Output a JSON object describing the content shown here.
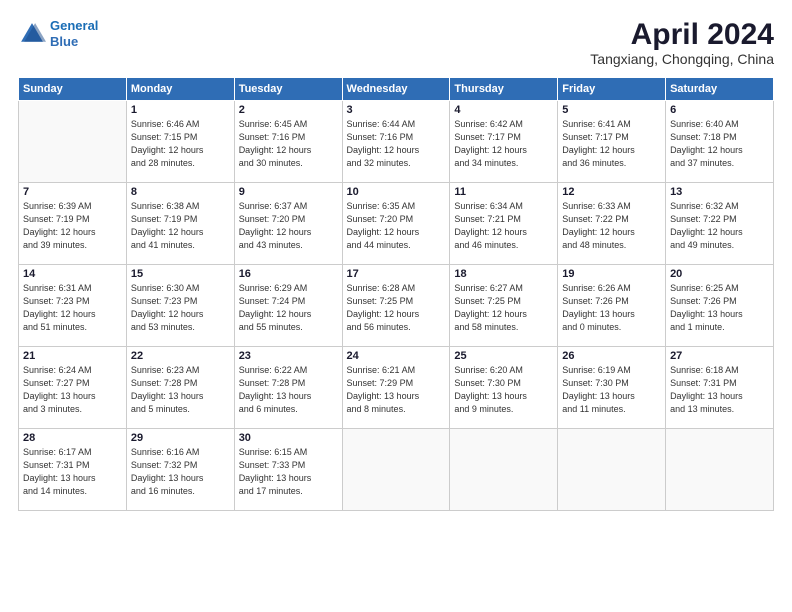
{
  "header": {
    "logo_line1": "General",
    "logo_line2": "Blue",
    "title": "April 2024",
    "location": "Tangxiang, Chongqing, China"
  },
  "days_of_week": [
    "Sunday",
    "Monday",
    "Tuesday",
    "Wednesday",
    "Thursday",
    "Friday",
    "Saturday"
  ],
  "weeks": [
    [
      {
        "num": "",
        "info": ""
      },
      {
        "num": "1",
        "info": "Sunrise: 6:46 AM\nSunset: 7:15 PM\nDaylight: 12 hours\nand 28 minutes."
      },
      {
        "num": "2",
        "info": "Sunrise: 6:45 AM\nSunset: 7:16 PM\nDaylight: 12 hours\nand 30 minutes."
      },
      {
        "num": "3",
        "info": "Sunrise: 6:44 AM\nSunset: 7:16 PM\nDaylight: 12 hours\nand 32 minutes."
      },
      {
        "num": "4",
        "info": "Sunrise: 6:42 AM\nSunset: 7:17 PM\nDaylight: 12 hours\nand 34 minutes."
      },
      {
        "num": "5",
        "info": "Sunrise: 6:41 AM\nSunset: 7:17 PM\nDaylight: 12 hours\nand 36 minutes."
      },
      {
        "num": "6",
        "info": "Sunrise: 6:40 AM\nSunset: 7:18 PM\nDaylight: 12 hours\nand 37 minutes."
      }
    ],
    [
      {
        "num": "7",
        "info": "Sunrise: 6:39 AM\nSunset: 7:19 PM\nDaylight: 12 hours\nand 39 minutes."
      },
      {
        "num": "8",
        "info": "Sunrise: 6:38 AM\nSunset: 7:19 PM\nDaylight: 12 hours\nand 41 minutes."
      },
      {
        "num": "9",
        "info": "Sunrise: 6:37 AM\nSunset: 7:20 PM\nDaylight: 12 hours\nand 43 minutes."
      },
      {
        "num": "10",
        "info": "Sunrise: 6:35 AM\nSunset: 7:20 PM\nDaylight: 12 hours\nand 44 minutes."
      },
      {
        "num": "11",
        "info": "Sunrise: 6:34 AM\nSunset: 7:21 PM\nDaylight: 12 hours\nand 46 minutes."
      },
      {
        "num": "12",
        "info": "Sunrise: 6:33 AM\nSunset: 7:22 PM\nDaylight: 12 hours\nand 48 minutes."
      },
      {
        "num": "13",
        "info": "Sunrise: 6:32 AM\nSunset: 7:22 PM\nDaylight: 12 hours\nand 49 minutes."
      }
    ],
    [
      {
        "num": "14",
        "info": "Sunrise: 6:31 AM\nSunset: 7:23 PM\nDaylight: 12 hours\nand 51 minutes."
      },
      {
        "num": "15",
        "info": "Sunrise: 6:30 AM\nSunset: 7:23 PM\nDaylight: 12 hours\nand 53 minutes."
      },
      {
        "num": "16",
        "info": "Sunrise: 6:29 AM\nSunset: 7:24 PM\nDaylight: 12 hours\nand 55 minutes."
      },
      {
        "num": "17",
        "info": "Sunrise: 6:28 AM\nSunset: 7:25 PM\nDaylight: 12 hours\nand 56 minutes."
      },
      {
        "num": "18",
        "info": "Sunrise: 6:27 AM\nSunset: 7:25 PM\nDaylight: 12 hours\nand 58 minutes."
      },
      {
        "num": "19",
        "info": "Sunrise: 6:26 AM\nSunset: 7:26 PM\nDaylight: 13 hours\nand 0 minutes."
      },
      {
        "num": "20",
        "info": "Sunrise: 6:25 AM\nSunset: 7:26 PM\nDaylight: 13 hours\nand 1 minute."
      }
    ],
    [
      {
        "num": "21",
        "info": "Sunrise: 6:24 AM\nSunset: 7:27 PM\nDaylight: 13 hours\nand 3 minutes."
      },
      {
        "num": "22",
        "info": "Sunrise: 6:23 AM\nSunset: 7:28 PM\nDaylight: 13 hours\nand 5 minutes."
      },
      {
        "num": "23",
        "info": "Sunrise: 6:22 AM\nSunset: 7:28 PM\nDaylight: 13 hours\nand 6 minutes."
      },
      {
        "num": "24",
        "info": "Sunrise: 6:21 AM\nSunset: 7:29 PM\nDaylight: 13 hours\nand 8 minutes."
      },
      {
        "num": "25",
        "info": "Sunrise: 6:20 AM\nSunset: 7:30 PM\nDaylight: 13 hours\nand 9 minutes."
      },
      {
        "num": "26",
        "info": "Sunrise: 6:19 AM\nSunset: 7:30 PM\nDaylight: 13 hours\nand 11 minutes."
      },
      {
        "num": "27",
        "info": "Sunrise: 6:18 AM\nSunset: 7:31 PM\nDaylight: 13 hours\nand 13 minutes."
      }
    ],
    [
      {
        "num": "28",
        "info": "Sunrise: 6:17 AM\nSunset: 7:31 PM\nDaylight: 13 hours\nand 14 minutes."
      },
      {
        "num": "29",
        "info": "Sunrise: 6:16 AM\nSunset: 7:32 PM\nDaylight: 13 hours\nand 16 minutes."
      },
      {
        "num": "30",
        "info": "Sunrise: 6:15 AM\nSunset: 7:33 PM\nDaylight: 13 hours\nand 17 minutes."
      },
      {
        "num": "",
        "info": ""
      },
      {
        "num": "",
        "info": ""
      },
      {
        "num": "",
        "info": ""
      },
      {
        "num": "",
        "info": ""
      }
    ]
  ]
}
